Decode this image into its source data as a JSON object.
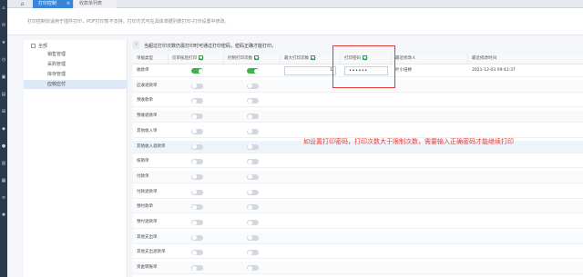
{
  "tabs": {
    "active": "打印控制",
    "inactive": "收款单列表",
    "close_mark": "×"
  },
  "notice": "打印控制仅适用于插件打印，PDF打印暂不支持。打印方式可在具体单据列表打印-打印设置中修改。",
  "tree": {
    "root": "全部",
    "items": [
      "销售管理",
      "采购管理",
      "库存管理",
      "应收应付"
    ],
    "selected_index": 3
  },
  "collapse_mark": "‹",
  "hint": "当超过打印次数仍需打印时可通过打印密码，密码正确才能打印。",
  "columns": [
    "单据类型",
    "仅审核后打印",
    "控制打印次数",
    "最大打印次数",
    "打印密码",
    "最近修改人",
    "最近修改时间"
  ],
  "rows": [
    {
      "type": "收款单",
      "audit_on": true,
      "limit_on": true,
      "max_count": "1",
      "password": "••••••",
      "modifier": "叶小培婷",
      "time": "2021-12-03 09:43:37"
    },
    {
      "type": "应收退款单",
      "audit_on": false,
      "limit_on": false
    },
    {
      "type": "预收款单",
      "audit_on": false,
      "limit_on": false
    },
    {
      "type": "预收退款单",
      "audit_on": false,
      "limit_on": false
    },
    {
      "type": "其他收入单",
      "audit_on": false,
      "limit_on": false
    },
    {
      "type": "其他收入退款单",
      "audit_on": false,
      "limit_on": false
    },
    {
      "type": "核销单",
      "audit_on": false,
      "limit_on": false
    },
    {
      "type": "付款单",
      "audit_on": false,
      "limit_on": false
    },
    {
      "type": "付款退款单",
      "audit_on": false,
      "limit_on": false
    },
    {
      "type": "预付款单",
      "audit_on": false,
      "limit_on": false
    },
    {
      "type": "预付退款单",
      "audit_on": false,
      "limit_on": false
    },
    {
      "type": "其他支出单",
      "audit_on": false,
      "limit_on": false
    },
    {
      "type": "其他支出退款单",
      "audit_on": false,
      "limit_on": false
    },
    {
      "type": "资金转账单",
      "audit_on": false,
      "limit_on": false
    }
  ],
  "annotation": "如设置打印密码，打印次数大于限制次数，需要输入正确密码才能继续打印",
  "rail_icons": [
    "home-icon",
    "mail-icon",
    "star-icon",
    "clock-icon",
    "wallet-icon",
    "chart-icon",
    "cart-icon",
    "box-icon",
    "user-icon",
    "report-icon",
    "doc-icon",
    "list-icon",
    "settings-icon"
  ],
  "colors": {
    "accent": "#3a86d6",
    "toggle_on": "#3cb34a",
    "annotation": "#e53935"
  }
}
